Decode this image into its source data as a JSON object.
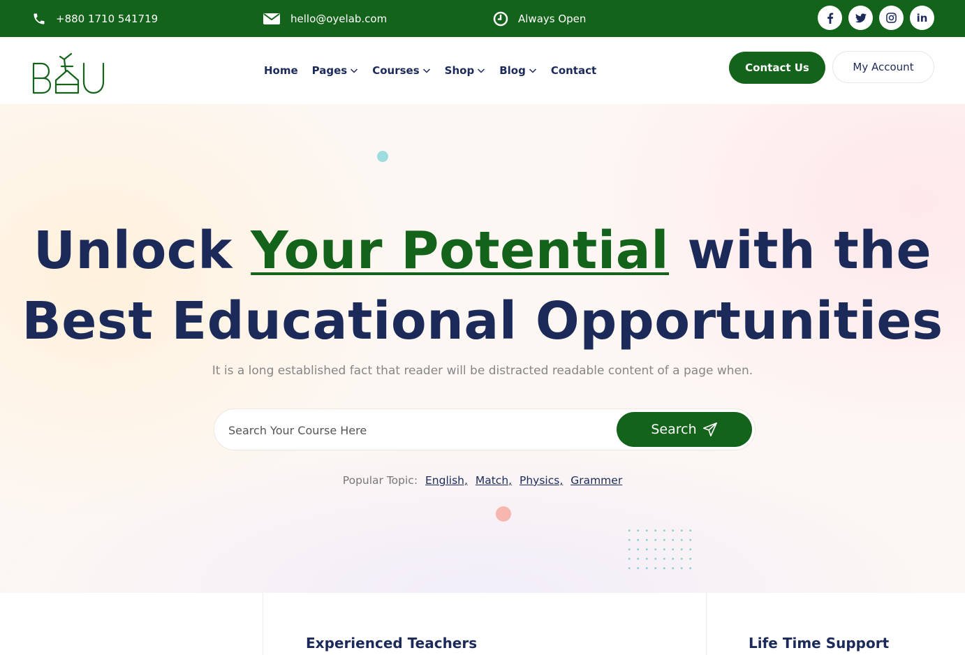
{
  "topbar": {
    "phone": "+880 1710 541719",
    "email": "hello@oyelab.com",
    "hours": "Always Open",
    "icons": [
      "phone-icon",
      "mail-icon",
      "clock-icon"
    ],
    "socials": [
      {
        "name": "facebook-icon",
        "glyph": "f"
      },
      {
        "name": "twitter-icon",
        "glyph": ""
      },
      {
        "name": "instagram-icon",
        "glyph": ""
      },
      {
        "name": "linkedin-icon",
        "glyph": "in"
      }
    ]
  },
  "nav": {
    "items": [
      {
        "label": "Home",
        "dropdown": false
      },
      {
        "label": "Pages",
        "dropdown": true
      },
      {
        "label": "Courses",
        "dropdown": true
      },
      {
        "label": "Shop",
        "dropdown": true
      },
      {
        "label": "Blog",
        "dropdown": true
      },
      {
        "label": "Contact",
        "dropdown": false
      }
    ],
    "contact_button": "Contact Us",
    "account_button": "My Account"
  },
  "hero": {
    "headline_pre": "Unlock ",
    "headline_highlight": "Your Potential",
    "headline_post": " with the",
    "headline_line2": "Best Educational Opportunities",
    "subtitle": "It is a long established fact that reader will be distracted readable content of a page when.",
    "search_placeholder": "Search Your Course Here",
    "search_button": "Search",
    "popular_label": "Popular Topic:",
    "popular_topics": [
      "English,",
      "Match,",
      "Physics,",
      "Grammer"
    ]
  },
  "features": {
    "items": [
      "Experienced Teachers",
      "Life Time Support"
    ]
  },
  "colors": {
    "primary_green": "#14631b",
    "navy": "#1c2a5a"
  }
}
